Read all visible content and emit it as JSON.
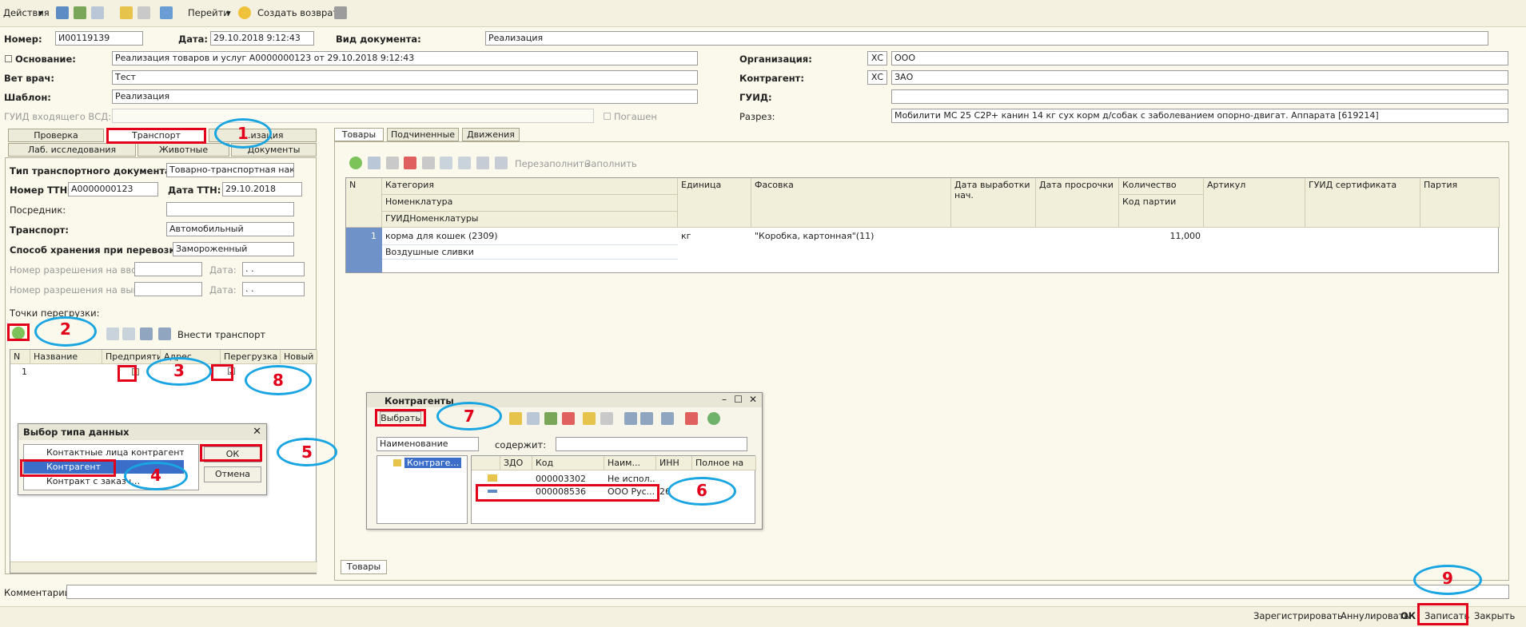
{
  "toolbar": {
    "actions": "Действия",
    "goto": "Перейти",
    "create_return": "Создать возврат"
  },
  "header": {
    "number_label": "Номер:",
    "number": "И00119139",
    "date_label": "Дата:",
    "date": "29.10.2018  9:12:43",
    "doctype_label": "Вид документа:",
    "doctype": "Реализация",
    "basis_label": "Основание:",
    "basis": "Реализация товаров и услуг А0000000123 от 29.10.2018 9:12:43",
    "org_label": "Организация:",
    "org_xs": "ХС",
    "org": "ООО",
    "vet_label": "Вет врач:",
    "vet": "Тест",
    "contr_label": "Контрагент:",
    "contr_xs": "ХС",
    "contr": "ЗАО",
    "tpl_label": "Шаблон:",
    "tpl": "Реализация",
    "guid_label": "ГУИД:",
    "guid": "",
    "vsd_label": "ГУИД входящего ВСД:",
    "vsd": "",
    "paid": "Погашен",
    "razrez_label": "Разрез:",
    "razrez": "Мобилити МС 25 С2Р+ канин 14 кг сух корм д/собак с заболеванием опорно-двигат. Аппарата [619214]"
  },
  "left_tabs": {
    "row1": [
      "Проверка",
      "Транспорт",
      "…изация"
    ],
    "row2": [
      "Лаб. исследования",
      "Животные",
      "Документы"
    ]
  },
  "transport": {
    "doc_type_label": "Тип транспортного документа:",
    "doc_type": "Товарно-транспортная накла",
    "ttn_label": "Номер ТТН:",
    "ttn": "А0000000123",
    "ttn_date_label": "Дата ТТН:",
    "ttn_date": "29.10.2018",
    "agent_label": "Посредник:",
    "transport_label": "Транспорт:",
    "transport": "Автомобильный",
    "storage_label": "Способ хранения при перевозке:",
    "storage": "Замороженный",
    "imp_label": "Номер разрешения на ввоз:",
    "imp_date_label": "Дата:",
    "imp_date": " .  .",
    "exp_label": "Номер разрешения на вывоз:",
    "exp_date_label": "Дата:",
    "exp_date": " .  .",
    "points_label": "Точки перегрузки:",
    "add_transport": "Внести транспорт"
  },
  "points_grid": {
    "headers": [
      "N",
      "Название",
      "Предприятие",
      "Адрес",
      "Перегрузка",
      "Новый тра"
    ],
    "row": {
      "n": "1"
    }
  },
  "right_tabs": [
    "Товары",
    "Подчиненные",
    "Движения"
  ],
  "goods_toolbar": {
    "refill": "Перезаполнить",
    "fill": "Заполнить"
  },
  "goods_grid": {
    "headers": {
      "n": "N",
      "cat": "Категория",
      "nom": "Номенклатура",
      "guidnom": "ГУИДНоменклатуры",
      "unit": "Единица",
      "pack": "Фасовка",
      "prod": "Дата выработки нач.",
      "exp": "Дата просрочки",
      "qty": "Количество",
      "lot": "Код партии",
      "art": "Артикул",
      "cert": "ГУИД сертификата",
      "part": "Партия"
    },
    "row": {
      "n": "1",
      "cat": "корма для кошек (2309)",
      "nom": "Воздушные сливки",
      "unit": "кг",
      "pack": "\"Коробка, картонная\"(11)",
      "qty": "11,000"
    }
  },
  "bottom_tab": "Товары",
  "type_dialog": {
    "title": "Выбор типа данных",
    "items": [
      "Контактные лица контрагентов",
      "Контрагент",
      "Контракт с заказч…"
    ],
    "ok": "ОК",
    "cancel": "Отмена"
  },
  "contr_dialog": {
    "title": "Контрагенты",
    "select": "Выбрать",
    "field": "Наименование",
    "contains": "содержит:",
    "tree": "Контраге…",
    "headers": [
      "ЗДО",
      "Код",
      "Наим...",
      "ИНН",
      "Полное на"
    ],
    "rows": [
      {
        "code": "000003302",
        "name": "Не испол..."
      },
      {
        "code": "000008536",
        "name": "ООО Рус...",
        "inn": "26"
      }
    ]
  },
  "comment_label": "Комментарий:",
  "footer": {
    "register": "Зарегистрировать",
    "cancel": "Аннулировать",
    "ok": "ОК",
    "save": "Записать",
    "close": "Закрыть"
  },
  "annotations": [
    "1",
    "2",
    "3",
    "4",
    "5",
    "6",
    "7",
    "8",
    "9"
  ],
  "colors": {
    "annotation_box": "#e2001a",
    "annotation_ellipse": "#19a5e2",
    "selection": "#3a6ec8"
  }
}
